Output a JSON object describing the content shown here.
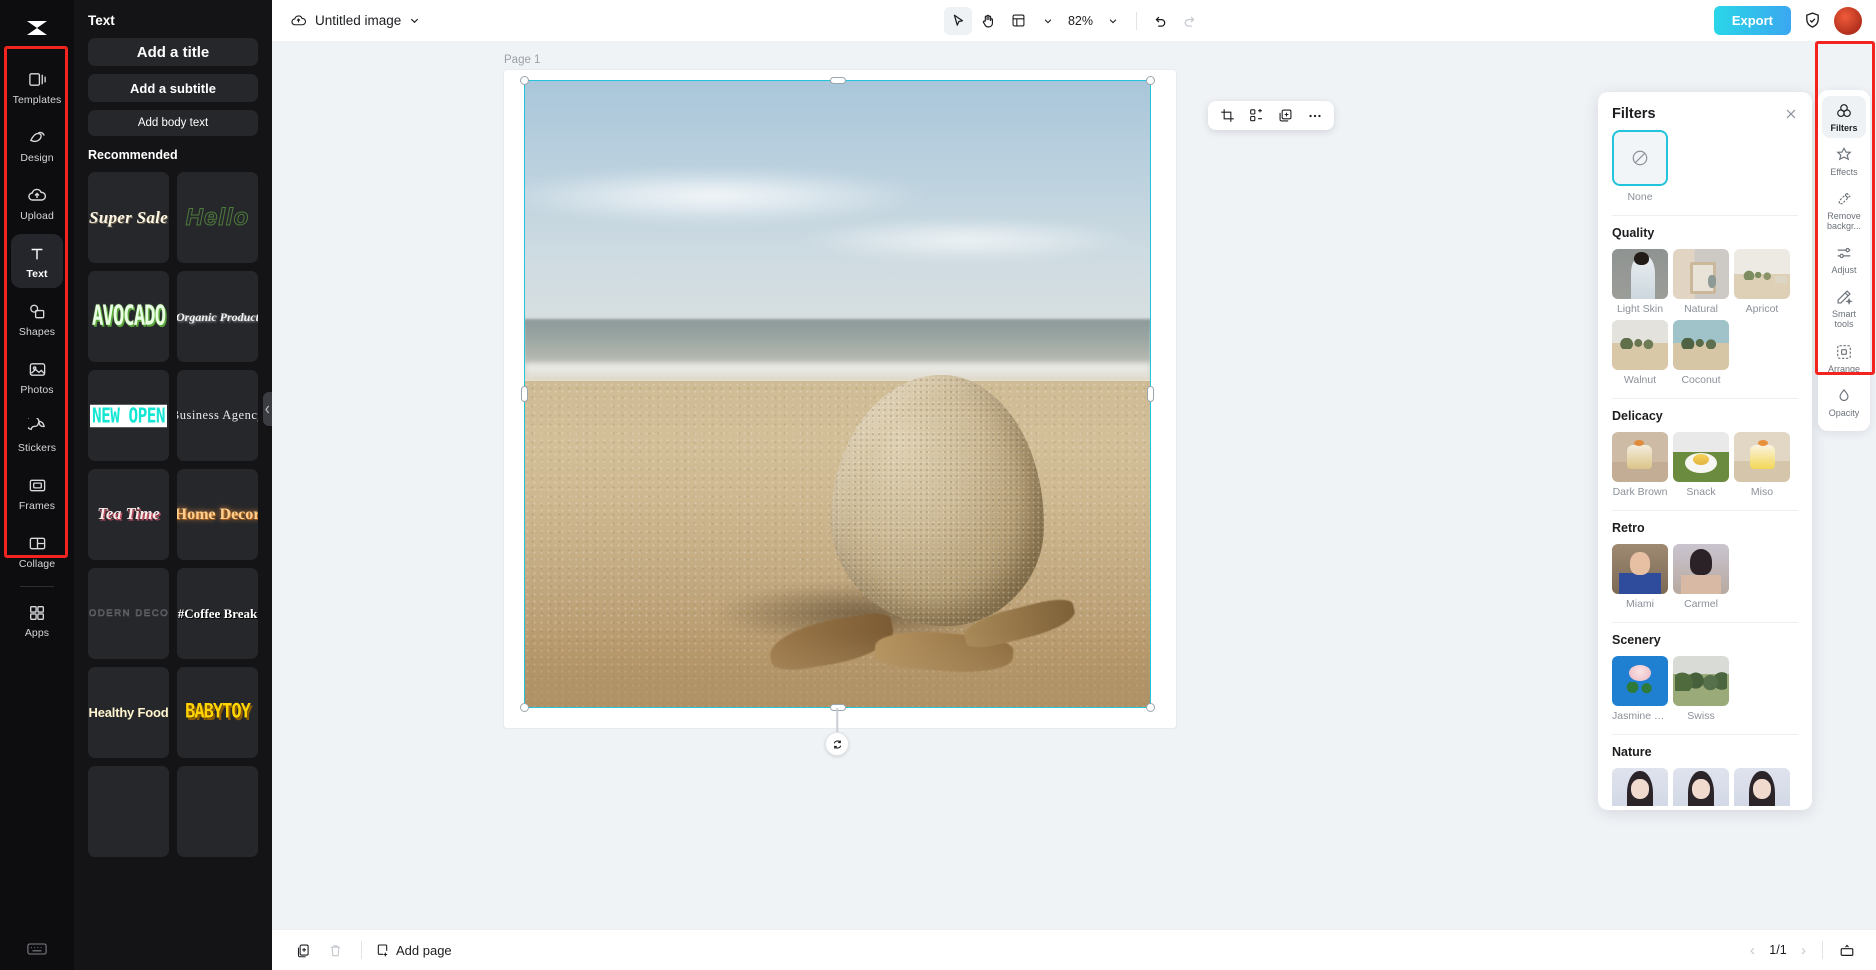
{
  "left_rail": {
    "logo": "capcut-logo",
    "items": [
      {
        "label": "Templates",
        "icon": "templates-icon",
        "active": false
      },
      {
        "label": "Design",
        "icon": "design-icon",
        "active": false
      },
      {
        "label": "Upload",
        "icon": "upload-icon",
        "active": false
      },
      {
        "label": "Text",
        "icon": "text-icon",
        "active": true
      },
      {
        "label": "Shapes",
        "icon": "shapes-icon",
        "active": false
      },
      {
        "label": "Photos",
        "icon": "photos-icon",
        "active": false
      },
      {
        "label": "Stickers",
        "icon": "stickers-icon",
        "active": false
      },
      {
        "label": "Frames",
        "icon": "frames-icon",
        "active": false
      },
      {
        "label": "Collage",
        "icon": "collage-icon",
        "active": false
      },
      {
        "label": "Apps",
        "icon": "apps-icon",
        "active": false
      }
    ],
    "bottom_icon": "keyboard-icon"
  },
  "text_panel": {
    "title": "Text",
    "buttons": [
      {
        "label": "Add a title"
      },
      {
        "label": "Add a subtitle"
      },
      {
        "label": "Add body text"
      }
    ],
    "recommended_title": "Recommended",
    "templates": [
      {
        "label": "Super Sale",
        "style": "s-supersale"
      },
      {
        "label": "Hello",
        "style": "s-hello"
      },
      {
        "label": "AVOCADO",
        "style": "s-avocado"
      },
      {
        "label": "Organic Product",
        "style": "s-organic"
      },
      {
        "label": "NEW OPEN",
        "style": "s-newopen"
      },
      {
        "label": "Business Agency",
        "style": "s-business"
      },
      {
        "label": "Tea Time",
        "style": "s-teatime"
      },
      {
        "label": "Home Decor",
        "style": "s-homedecor"
      },
      {
        "label": "MODERN DECOR",
        "style": "s-modern"
      },
      {
        "label": "#Coffee Break",
        "style": "s-coffee"
      },
      {
        "label": "Healthy Food",
        "style": "s-healthy"
      },
      {
        "label": "BABYTOY",
        "style": "s-babytoy"
      }
    ],
    "collapse_handle": "collapse-panel-handle"
  },
  "topbar": {
    "cloud_icon": "cloud-save-icon",
    "doc_title": "Untitled image",
    "doc_chevron": "chevron-down-icon",
    "select_tool": "cursor-select-icon",
    "hand_tool": "hand-pan-icon",
    "fit_tool": "fit-page-icon",
    "fit_chevron": "chevron-down-icon",
    "zoom_level": "82%",
    "zoom_chevron": "chevron-down-icon",
    "undo": "undo-icon",
    "redo": "redo-icon",
    "export_label": "Export",
    "shield_icon": "shield-check-icon",
    "avatar": "user-avatar"
  },
  "canvas": {
    "page_label": "Page 1",
    "image_alt": "beach-stone-photo",
    "float_tools": [
      {
        "name": "crop-icon"
      },
      {
        "name": "flip-align-icon"
      },
      {
        "name": "duplicate-icon"
      },
      {
        "name": "more-options-icon"
      }
    ],
    "rotate_handle": "rotate-icon"
  },
  "filters_panel": {
    "title": "Filters",
    "close_icon": "close-icon",
    "none_label": "None",
    "none_icon": "no-filter-icon",
    "sections": [
      {
        "name": "Quality",
        "items": [
          {
            "label": "Light Skin",
            "thumb": "th-lightskin"
          },
          {
            "label": "Natural",
            "thumb": "th-natural"
          },
          {
            "label": "Apricot",
            "thumb": "th-desert"
          },
          {
            "label": "Walnut",
            "thumb": "th-walnut"
          },
          {
            "label": "Coconut",
            "thumb": "th-coconut"
          }
        ]
      },
      {
        "name": "Delicacy",
        "items": [
          {
            "label": "Dark Brown",
            "thumb": "th-darkbrown"
          },
          {
            "label": "Snack",
            "thumb": "th-snack"
          },
          {
            "label": "Miso",
            "thumb": "th-miso"
          }
        ]
      },
      {
        "name": "Retro",
        "items": [
          {
            "label": "Miami",
            "thumb": "th-miami"
          },
          {
            "label": "Carmel",
            "thumb": "th-carmel"
          }
        ]
      },
      {
        "name": "Scenery",
        "items": [
          {
            "label": "Jasmine Tea",
            "thumb": "th-jasmine"
          },
          {
            "label": "Swiss",
            "thumb": "th-swiss"
          }
        ]
      },
      {
        "name": "Nature",
        "items": [
          {
            "label": "",
            "thumb": "th-portrait"
          },
          {
            "label": "",
            "thumb": "th-portrait"
          },
          {
            "label": "",
            "thumb": "th-portrait"
          }
        ]
      }
    ]
  },
  "right_rail": {
    "items": [
      {
        "label": "Filters",
        "icon": "filters-icon",
        "active": true
      },
      {
        "label": "Effects",
        "icon": "effects-icon",
        "active": false
      },
      {
        "label": "Remove backgr...",
        "icon": "remove-background-icon",
        "active": false
      },
      {
        "label": "Adjust",
        "icon": "adjust-sliders-icon",
        "active": false
      },
      {
        "label": "Smart tools",
        "icon": "smart-tools-icon",
        "active": false
      },
      {
        "label": "Arrange",
        "icon": "arrange-icon",
        "active": false
      },
      {
        "label": "Opacity",
        "icon": "opacity-icon",
        "active": false
      }
    ]
  },
  "bottombar": {
    "duplicate_page_icon": "duplicate-page-icon",
    "delete_page_icon": "delete-page-icon",
    "add_page_icon": "add-page-icon",
    "add_page_label": "Add page",
    "prev_icon": "chevron-left-icon",
    "page_indicator": "1/1",
    "next_icon": "chevron-right-icon",
    "timeline_icon": "timeline-icon"
  },
  "annotations": {
    "highlight_color": "#f3231f",
    "left_box": "left-rail-highlight",
    "right_box": "right-rail-highlight"
  }
}
